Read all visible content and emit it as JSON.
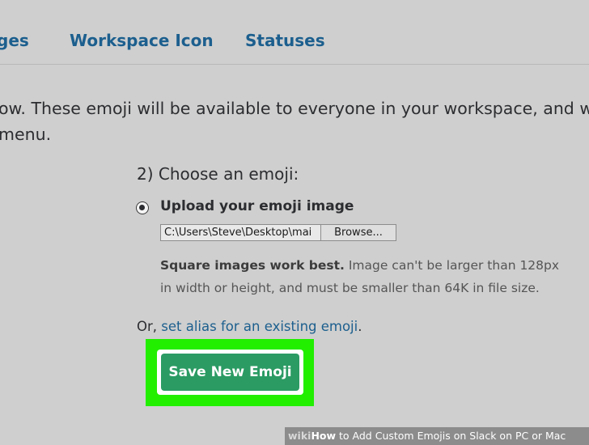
{
  "nav": {
    "tabs": [
      {
        "label": "ges"
      },
      {
        "label": "Workspace Icon"
      },
      {
        "label": "Statuses"
      }
    ]
  },
  "intro": {
    "line1": "ow. These emoji will be available to everyone in your workspace, and will",
    "line2": "menu."
  },
  "form": {
    "heading": "2) Choose an emoji:",
    "upload_option": {
      "label": "Upload your emoji image",
      "selected": true
    },
    "file_path": "C:\\Users\\Steve\\Desktop\\mai",
    "browse_label": "Browse...",
    "hint_bold": "Square images work best.",
    "hint_rest1": " Image can't be larger than 128px",
    "hint_line2": "in width or height, and must be smaller than 64K in file size.",
    "alias_prefix": "Or, ",
    "alias_link": "set alias for an existing emoji",
    "alias_suffix": ".",
    "save_label": "Save New Emoji"
  },
  "colors": {
    "link": "#1c5f8e",
    "save_button": "#2b9b63",
    "highlight": "#22ee00",
    "background": "#cfcfcf"
  },
  "watermark": {
    "wiki": "wiki",
    "how": "How",
    "rest": " to Add Custom Emojis on Slack on PC or Mac"
  }
}
